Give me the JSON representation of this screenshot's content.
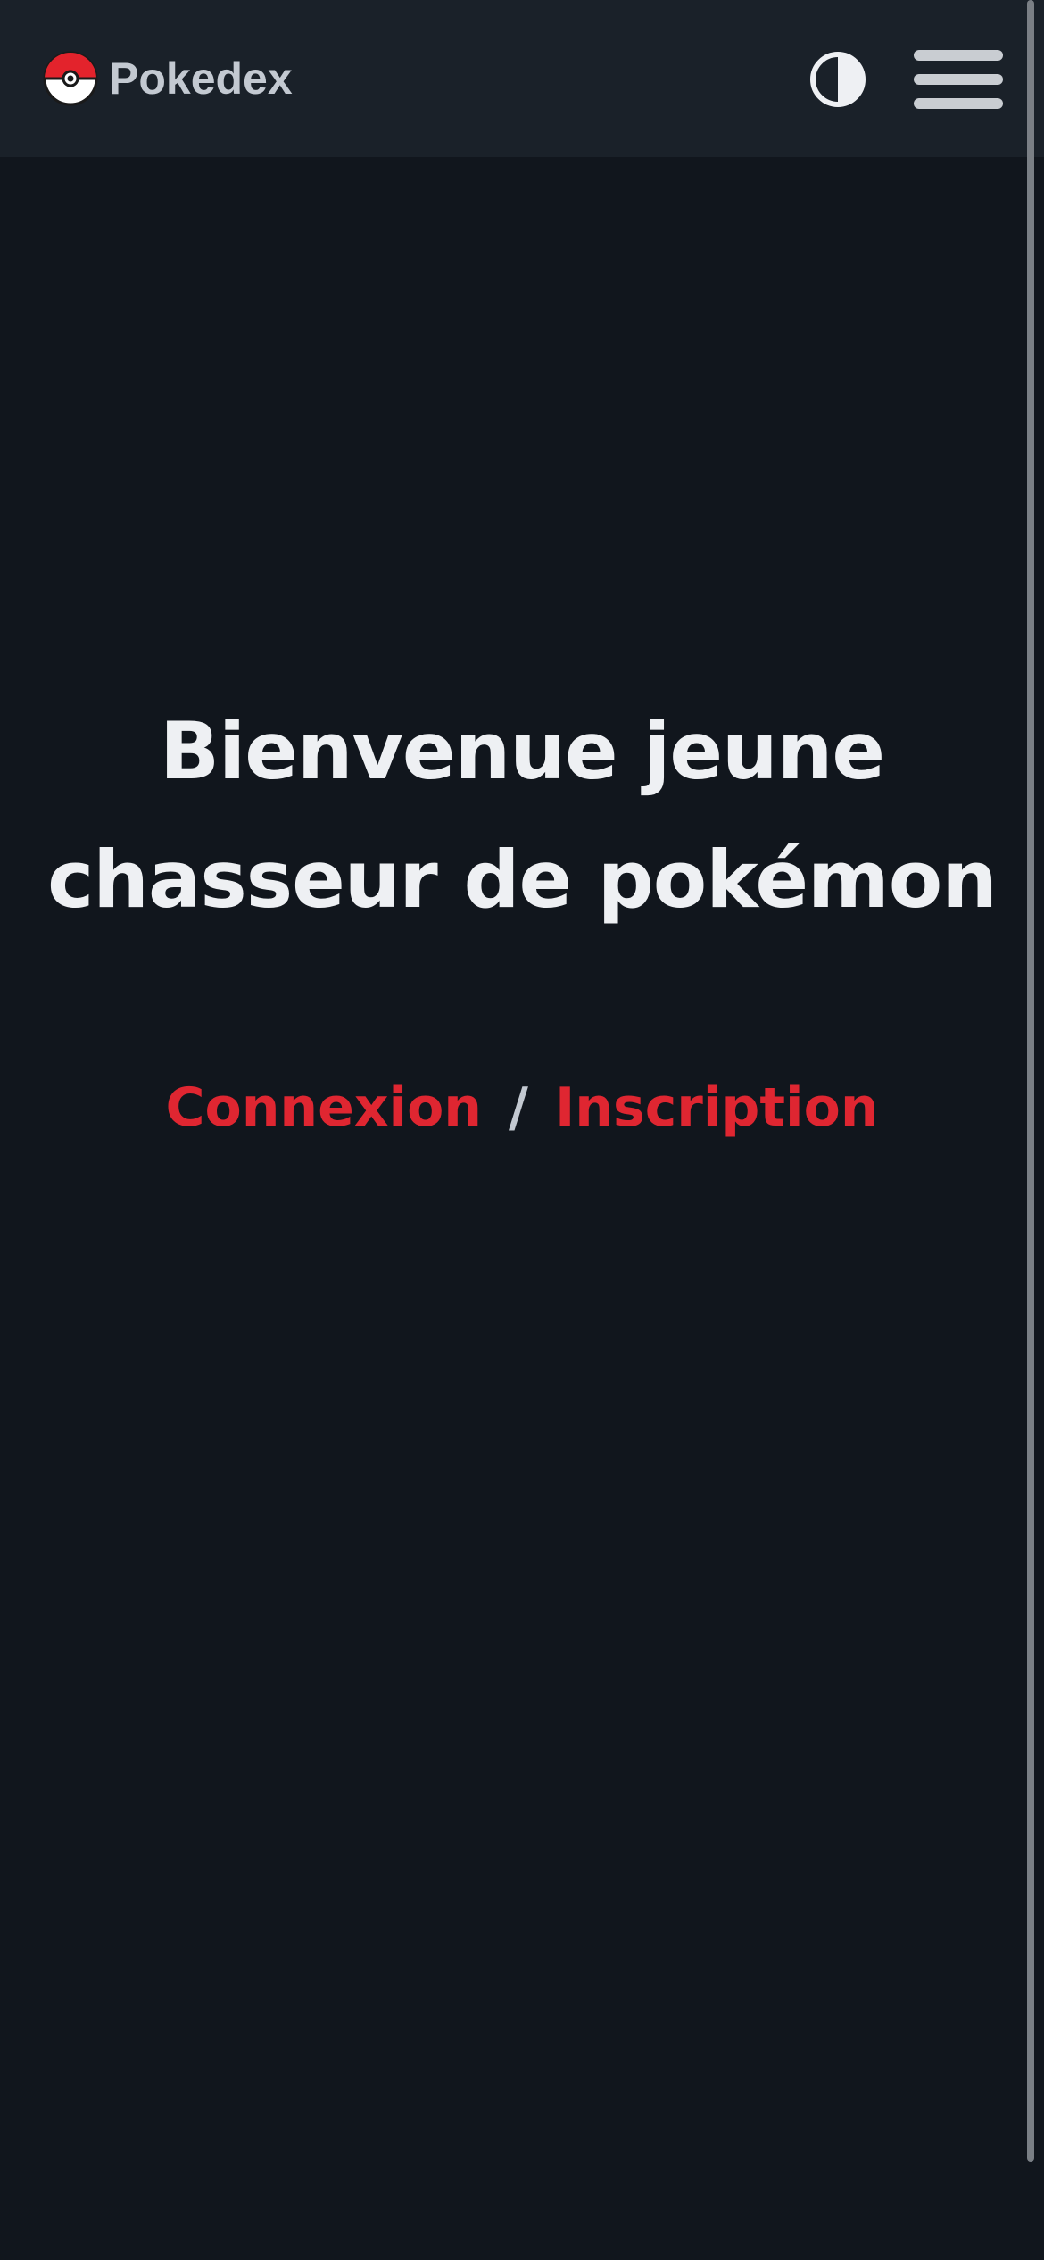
{
  "navbar": {
    "brand_label": "Pokedex",
    "brand_icon": "pokeball-icon",
    "theme_toggle_icon": "contrast-icon",
    "menu_icon": "hamburger-menu-icon"
  },
  "hero": {
    "title_line1": "Bienvenue jeune",
    "title_line2": "chasseur de pokémon"
  },
  "auth": {
    "login_label": "Connexion",
    "separator": "/",
    "register_label": "Inscription"
  },
  "colors": {
    "background": "#11161d",
    "navbar": "#1a2129",
    "accent": "#df2631",
    "title": "#eef0f3",
    "brand_text": "#c3c9d1"
  }
}
